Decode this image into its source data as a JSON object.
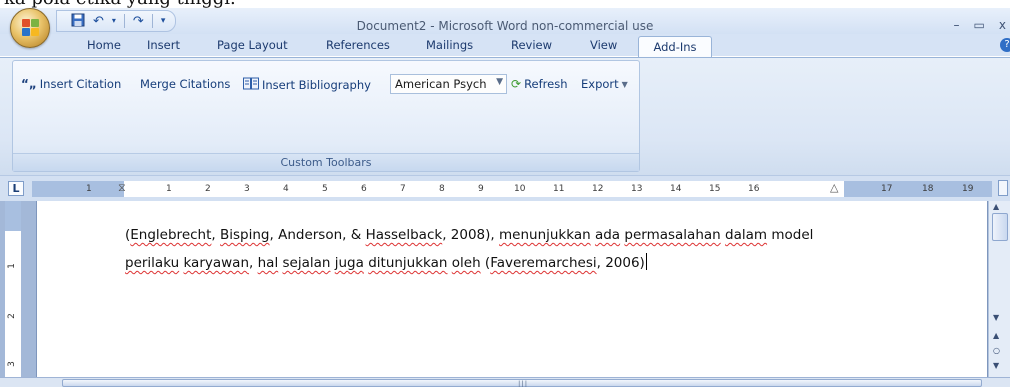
{
  "top_fragment": "ka pola etika yang tinggi.",
  "title_bar": {
    "title": "Document2 - Microsoft Word non-commercial use",
    "minimize": "–",
    "maximize": "▭",
    "close": "x"
  },
  "quick_access": {
    "save_icon": "save-icon",
    "undo_icon": "undo-icon",
    "redo_icon": "redo-icon",
    "customize_icon": "customize-icon"
  },
  "tabs": [
    {
      "label": "Home"
    },
    {
      "label": "Insert"
    },
    {
      "label": "Page Layout"
    },
    {
      "label": "References"
    },
    {
      "label": "Mailings"
    },
    {
      "label": "Review"
    },
    {
      "label": "View"
    },
    {
      "label": "Add-Ins"
    }
  ],
  "ribbon": {
    "insert_citation": "Insert Citation",
    "merge_citations": "Merge Citations",
    "insert_bibliography": "Insert Bibliography",
    "style_value": "American Psych",
    "refresh": "Refresh",
    "export": "Export",
    "group_label": "Custom Toolbars"
  },
  "ruler": {
    "tab_selector": "L",
    "numbers": [
      "1",
      "1",
      "2",
      "3",
      "4",
      "5",
      "6",
      "7",
      "8",
      "9",
      "10",
      "11",
      "12",
      "13",
      "14",
      "15",
      "16",
      "17",
      "18",
      "19"
    ],
    "vertical_numbers": [
      "1",
      "2",
      "3"
    ]
  },
  "document": {
    "line1": {
      "c1": "(",
      "w1": "Englebrecht",
      "c2": ", ",
      "w2": "Bisping",
      "c3": ", Anderson, & ",
      "w3": "Hasselback",
      "c4": ", 2008), ",
      "w4": "menunjukkan",
      "c5": " ",
      "w5": "ada",
      "c6": " ",
      "w6": "permasalahan",
      "c7": " ",
      "w7": "dalam",
      "c8": " model"
    },
    "line2": {
      "w1": "perilaku",
      "c1": " ",
      "w2": "karyawan",
      "c2": ", ",
      "w3": "hal",
      "c3": " ",
      "w4": "sejalan",
      "c4": " ",
      "w5": "juga",
      "c5": " ",
      "w6": "ditunjukkan",
      "c6": " ",
      "w7": "oleh",
      "c7": " (",
      "w8": "Faveremarchesi",
      "c8": ", 2006)"
    }
  },
  "colors": {
    "ribbon_text": "#163d7a",
    "spell_underline": "#dd3333",
    "frame": "#a3b8d8"
  }
}
